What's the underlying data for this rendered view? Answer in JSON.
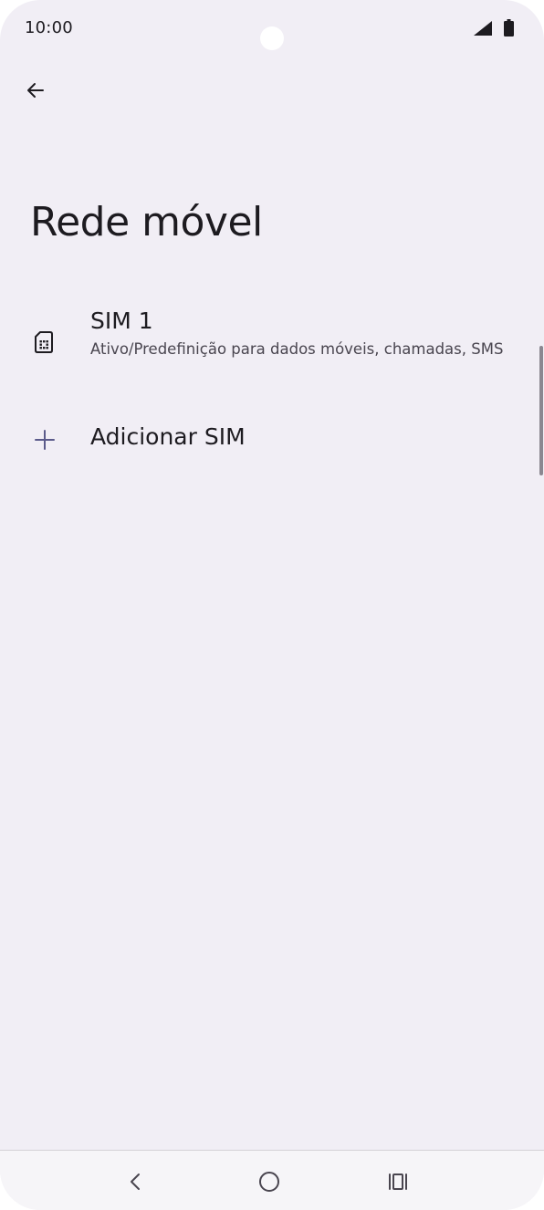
{
  "status_bar": {
    "time": "10:00",
    "icons": [
      "signal-icon",
      "battery-icon"
    ]
  },
  "header": {
    "back_icon": "arrow-back-icon",
    "title": "Rede móvel"
  },
  "list": {
    "sim1": {
      "icon": "sim-card-icon",
      "title": "SIM 1",
      "summary": "Ativo/Predefinição para dados móveis, chamadas, SMS"
    },
    "add_sim": {
      "icon": "plus-icon",
      "label": "Adicionar SIM"
    }
  },
  "navigation_bar": {
    "buttons": [
      "nav-back-icon",
      "nav-home-icon",
      "nav-recents-icon"
    ]
  },
  "colors": {
    "background": "#f1eef5",
    "text_primary": "#1d1b20",
    "text_secondary": "#49454f",
    "accent": "#5b5a8a"
  }
}
